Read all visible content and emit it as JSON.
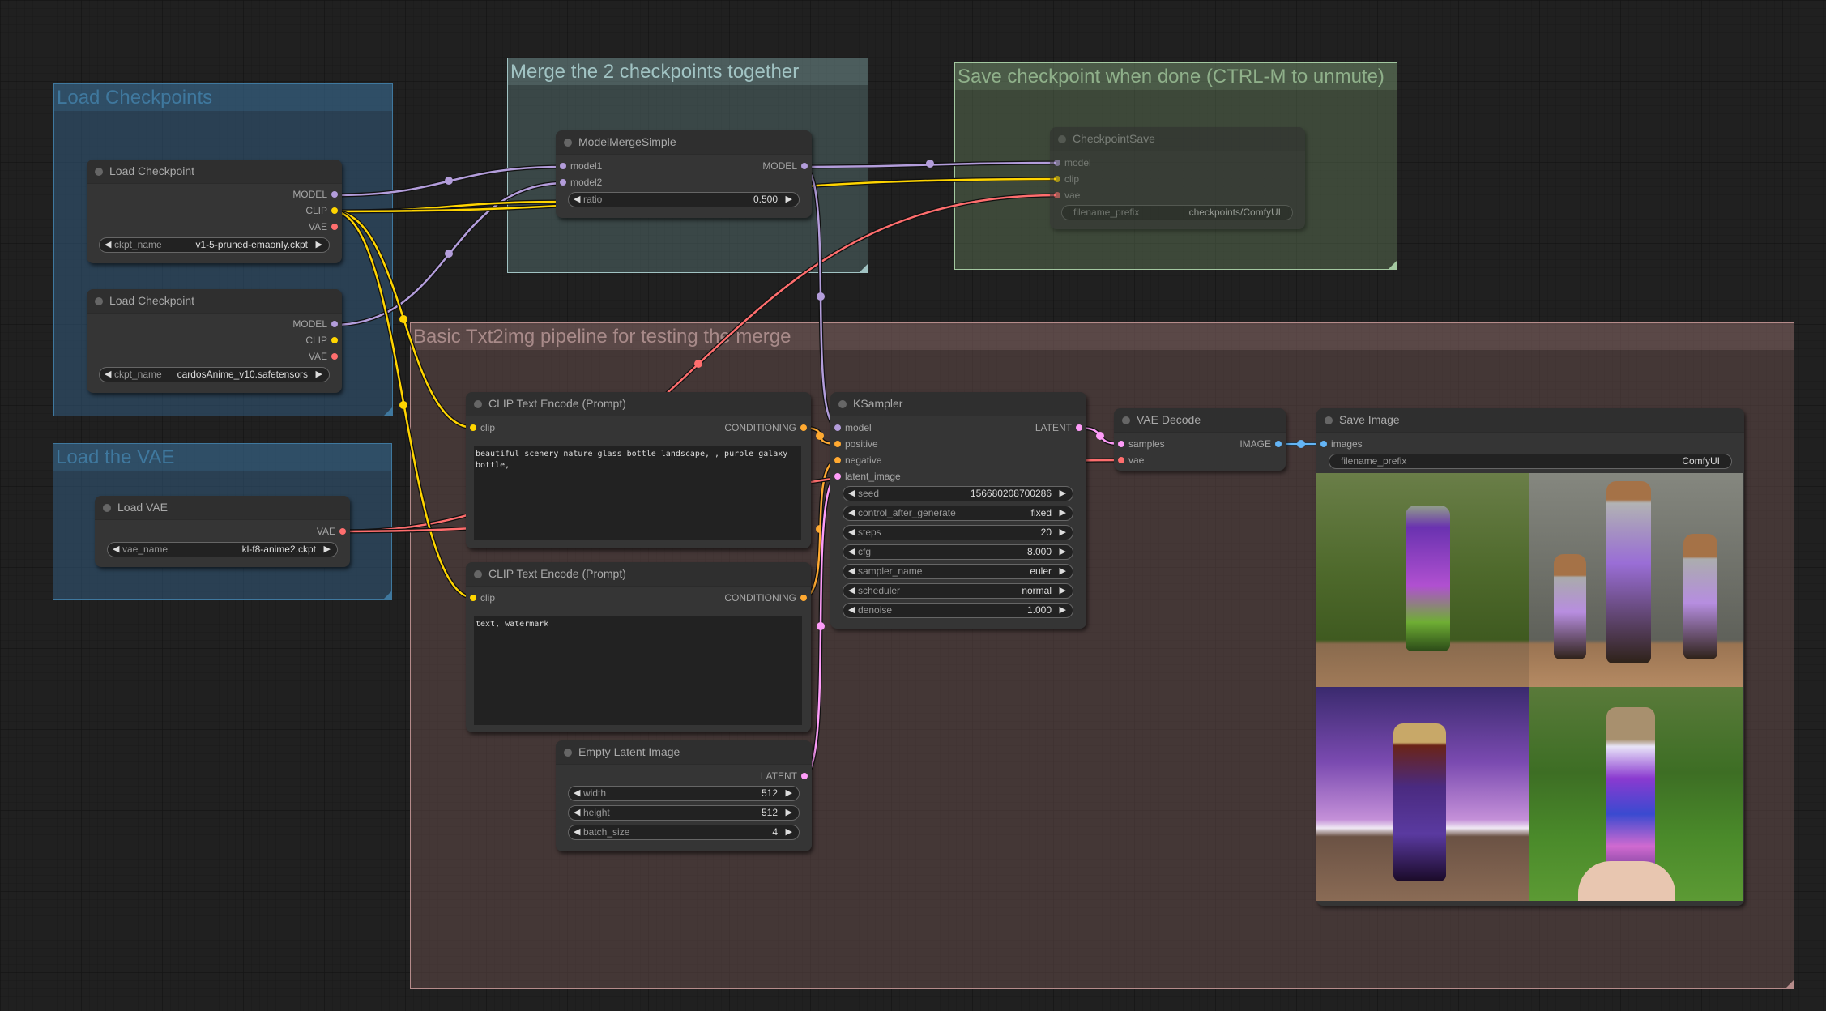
{
  "groups": {
    "load_checkpoints": "Load Checkpoints",
    "load_vae": "Load the VAE",
    "merge": "Merge the 2 checkpoints together",
    "save_checkpoint": "Save checkpoint when done (CTRL-M to unmute)",
    "txt2img": "Basic Txt2img pipeline for testing the merge"
  },
  "colors": {
    "model": "#b39ddb",
    "clip": "#ffd500",
    "vae": "#ff6e6e",
    "conditioning": "#ffa931",
    "latent": "#ff9cf9",
    "image": "#64b5f6"
  },
  "nodes": {
    "load_checkpoint_1": {
      "title": "Load Checkpoint",
      "outputs": [
        "MODEL",
        "CLIP",
        "VAE"
      ],
      "widgets": [
        {
          "label": "ckpt_name",
          "value": "v1-5-pruned-emaonly.ckpt"
        }
      ]
    },
    "load_checkpoint_2": {
      "title": "Load Checkpoint",
      "outputs": [
        "MODEL",
        "CLIP",
        "VAE"
      ],
      "widgets": [
        {
          "label": "ckpt_name",
          "value": "cardosAnime_v10.safetensors"
        }
      ]
    },
    "load_vae": {
      "title": "Load VAE",
      "outputs": [
        "VAE"
      ],
      "widgets": [
        {
          "label": "vae_name",
          "value": "kl-f8-anime2.ckpt"
        }
      ]
    },
    "model_merge": {
      "title": "ModelMergeSimple",
      "inputs": [
        "model1",
        "model2"
      ],
      "outputs": [
        "MODEL"
      ],
      "widgets": [
        {
          "label": "ratio",
          "value": "0.500"
        }
      ]
    },
    "checkpoint_save": {
      "title": "CheckpointSave",
      "inputs": [
        "model",
        "clip",
        "vae"
      ],
      "widgets": [
        {
          "label": "filename_prefix",
          "value": "checkpoints/ComfyUI"
        }
      ]
    },
    "clip_pos": {
      "title": "CLIP Text Encode (Prompt)",
      "inputs": [
        "clip"
      ],
      "outputs": [
        "CONDITIONING"
      ],
      "text": "beautiful scenery nature glass bottle landscape, , purple galaxy bottle,"
    },
    "clip_neg": {
      "title": "CLIP Text Encode (Prompt)",
      "inputs": [
        "clip"
      ],
      "outputs": [
        "CONDITIONING"
      ],
      "text": "text, watermark"
    },
    "empty_latent": {
      "title": "Empty Latent Image",
      "outputs": [
        "LATENT"
      ],
      "widgets": [
        {
          "label": "width",
          "value": "512"
        },
        {
          "label": "height",
          "value": "512"
        },
        {
          "label": "batch_size",
          "value": "4"
        }
      ]
    },
    "ksampler": {
      "title": "KSampler",
      "inputs": [
        "model",
        "positive",
        "negative",
        "latent_image"
      ],
      "outputs": [
        "LATENT"
      ],
      "widgets": [
        {
          "label": "seed",
          "value": "156680208700286"
        },
        {
          "label": "control_after_generate",
          "value": "fixed"
        },
        {
          "label": "steps",
          "value": "20"
        },
        {
          "label": "cfg",
          "value": "8.000"
        },
        {
          "label": "sampler_name",
          "value": "euler"
        },
        {
          "label": "scheduler",
          "value": "normal"
        },
        {
          "label": "denoise",
          "value": "1.000"
        }
      ]
    },
    "vae_decode": {
      "title": "VAE Decode",
      "inputs": [
        "samples",
        "vae"
      ],
      "outputs": [
        "IMAGE"
      ]
    },
    "save_image": {
      "title": "Save Image",
      "inputs": [
        "images"
      ],
      "widgets": [
        {
          "label": "filename_prefix",
          "value": "ComfyUI"
        }
      ],
      "images": [
        "glass bottle with purple galaxy on wooden table, forest background",
        "three corked bottles with purple flowers on wooden table",
        "amber bottle with galaxy inside, purple night sky background",
        "hand holding corked bottle with galaxy, green forest background"
      ]
    }
  }
}
